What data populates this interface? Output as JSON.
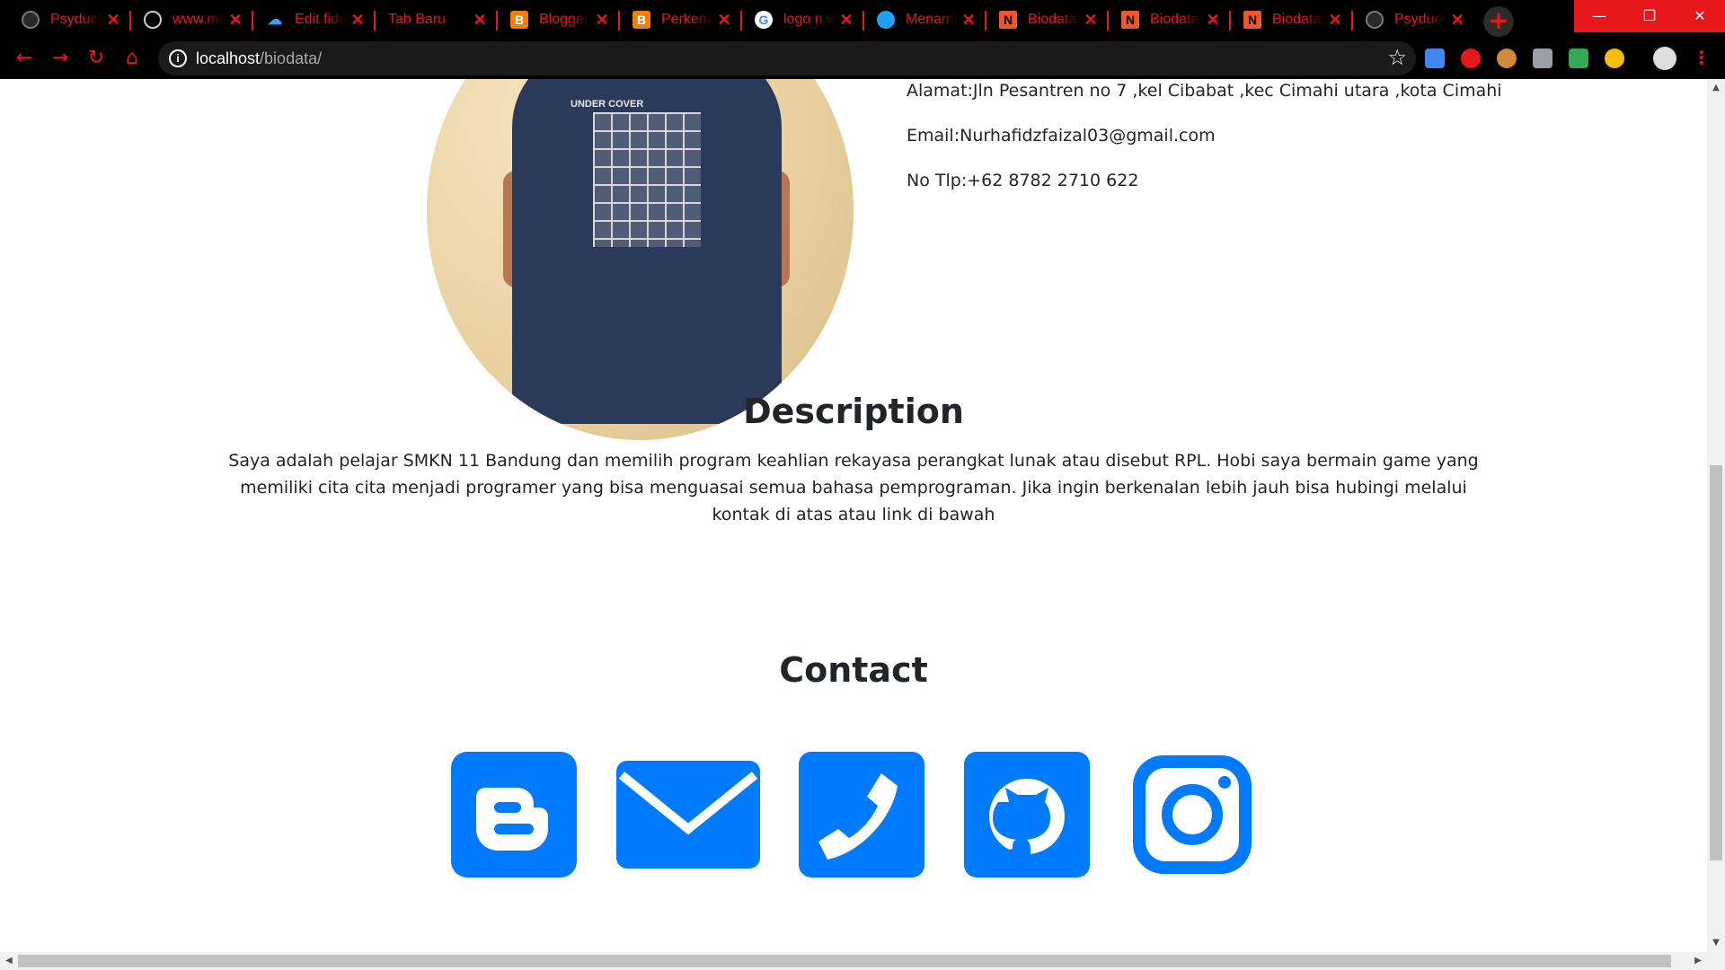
{
  "browser": {
    "tabs": [
      {
        "title": "Psyduck",
        "favicon": "github-icon"
      },
      {
        "title": "www.ma",
        "favicon": "globe-icon"
      },
      {
        "title": "Edit fidd",
        "favicon": "cloud-icon"
      },
      {
        "title": "Tab Baru",
        "favicon": ""
      },
      {
        "title": "Blogger",
        "favicon": "blogger-icon"
      },
      {
        "title": "Perkenal",
        "favicon": "blogger-icon"
      },
      {
        "title": "logo n w",
        "favicon": "google-icon"
      },
      {
        "title": "Menamb",
        "favicon": "bird-icon"
      },
      {
        "title": "Biodata",
        "favicon": "n-icon"
      },
      {
        "title": "Biodata",
        "favicon": "n-icon"
      },
      {
        "title": "Biodata",
        "favicon": "n-icon"
      },
      {
        "title": "Psyduck",
        "favicon": "github-icon"
      }
    ],
    "new_tab_symbol": "+",
    "url_host": "localhost",
    "url_path": "/biodata/",
    "accent_color": "#e8171b"
  },
  "profile": {
    "address": "Alamat:Jln Pesantren no 7 ,kel Cibabat ,kec Cimahi utara ,kota Cimahi",
    "email": "Email:Nurhafidzfaizal03@gmail.com",
    "phone": "No Tlp:+62 8782 2710 622",
    "photo_shirt_text": "UNDER COVER"
  },
  "description": {
    "title": "Description",
    "text": "Saya adalah pelajar SMKN 11 Bandung dan memilih program keahlian rekayasa perangkat lunak atau disebut RPL. Hobi saya bermain game yang memiliki cita cita menjadi programer yang bisa menguasai semua bahasa pemprograman. Jika ingin berkenalan lebih jauh bisa hubingi melalui kontak di atas atau link di bawah"
  },
  "contact": {
    "title": "Contact",
    "icon_color": "#007bff",
    "icons": [
      "blogger-icon",
      "mail-icon",
      "phone-icon",
      "github-icon",
      "instagram-icon"
    ]
  }
}
